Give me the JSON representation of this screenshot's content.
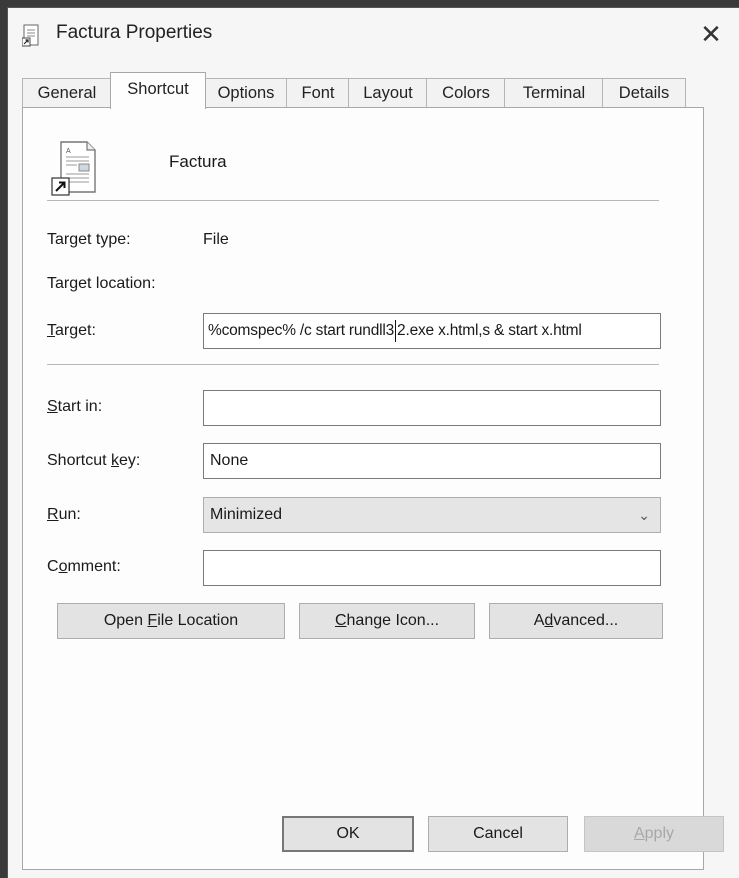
{
  "window": {
    "title": "Factura Properties",
    "close_icon": "close-icon",
    "close_glyph": "✕"
  },
  "tabs": [
    {
      "label": "General"
    },
    {
      "label": "Shortcut",
      "active": true
    },
    {
      "label": "Options"
    },
    {
      "label": "Font"
    },
    {
      "label": "Layout"
    },
    {
      "label": "Colors"
    },
    {
      "label": "Terminal"
    },
    {
      "label": "Details"
    }
  ],
  "shortcut": {
    "name": "Factura",
    "target_type_label": "Target type:",
    "target_type_value": "File",
    "target_location_label": "Target location:",
    "target_label_pre": "",
    "target_label_u": "T",
    "target_label_post": "arget:",
    "target_value_a": "%comspec% /c start rundll3",
    "target_value_b": "2.exe x.html,s & start x.html",
    "start_in_label_u": "S",
    "start_in_label_post": "tart in:",
    "start_in_value": "",
    "shortcut_key_label_pre": "Shortcut ",
    "shortcut_key_label_u": "k",
    "shortcut_key_label_post": "ey:",
    "shortcut_key_value": "None",
    "run_label_u": "R",
    "run_label_post": "un:",
    "run_value": "Minimized",
    "comment_label_pre": "C",
    "comment_label_u": "o",
    "comment_label_post": "mment:",
    "comment_value": ""
  },
  "buttons": {
    "open_pre": "Open ",
    "open_u": "F",
    "open_post": "ile Location",
    "change_u": "C",
    "change_post": "hange Icon...",
    "advanced_pre": "A",
    "advanced_u": "d",
    "advanced_post": "vanced...",
    "ok": "OK",
    "cancel": "Cancel",
    "apply_u": "A",
    "apply_post": "pply"
  },
  "colors": {
    "window_bg": "#f6f6f6",
    "panel_bg": "#fdfdfd",
    "button_bg": "#e3e3e3",
    "disabled_text": "#a8a8a8"
  }
}
